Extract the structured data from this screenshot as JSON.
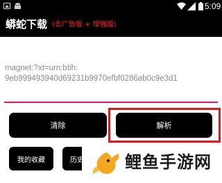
{
  "status_bar": {
    "time": "5:09",
    "icons": [
      "image-icon",
      "android-icon",
      "wifi-icon",
      "signal-icon",
      "battery-icon"
    ]
  },
  "app_bar": {
    "title": "蟒蛇下载",
    "subtitle": "(去广告版 + 增强版)",
    "subtitle_color": "#ff2828"
  },
  "magnet_input": {
    "value": "magnet:?xt=urn:btih:\n9eb999493940d69231b9970efbf0286ab0c9e3d1",
    "underline_color": "#d81b60"
  },
  "buttons": {
    "clear_label": "清除",
    "parse_label": "解析",
    "favorites_label": "我的收藏",
    "history_label": "历史"
  },
  "highlight": {
    "color": "#e0191f"
  },
  "watermark": {
    "text": "鲤鱼手游网",
    "icon": "fish-icon",
    "icon_color": "#f5a623"
  }
}
